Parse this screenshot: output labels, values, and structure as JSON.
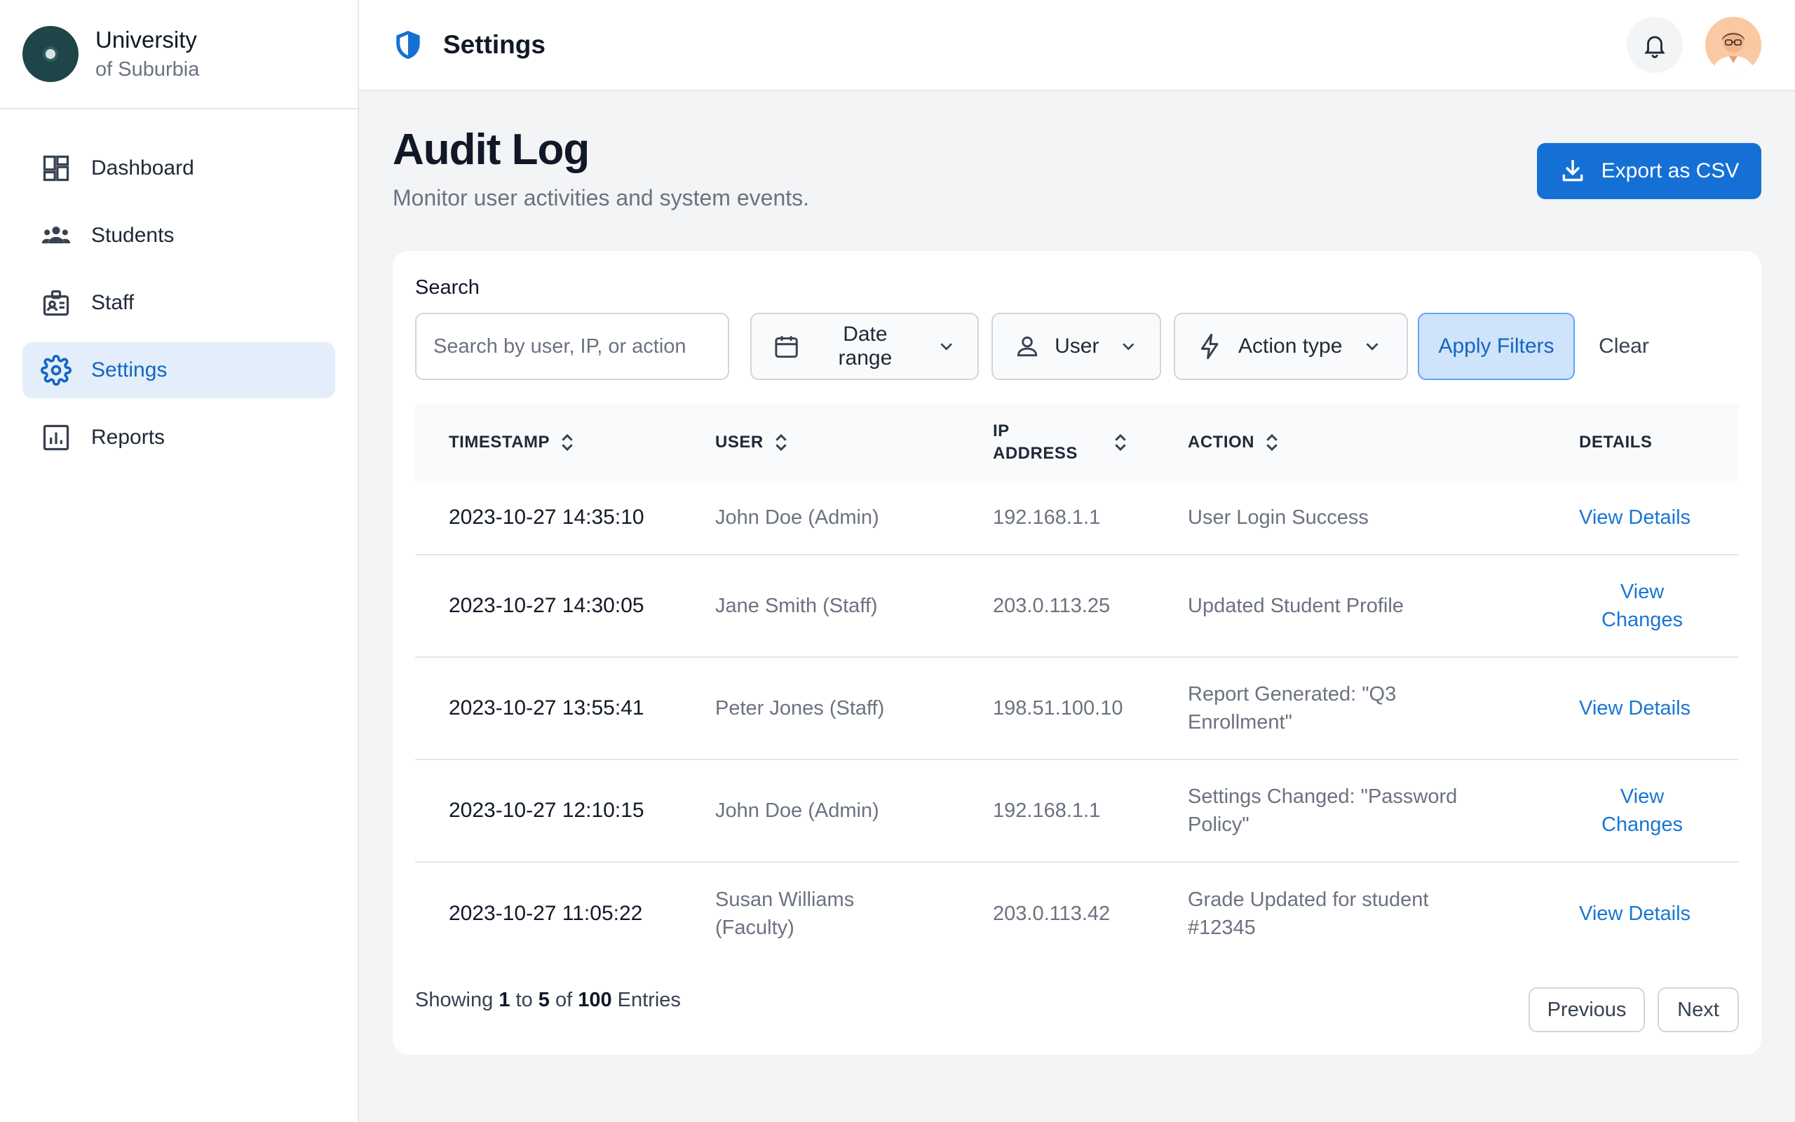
{
  "brand": {
    "line1": "University",
    "line2": "of Suburbia"
  },
  "sidebar": {
    "items": [
      {
        "label": "Dashboard",
        "icon": "dashboard-icon"
      },
      {
        "label": "Students",
        "icon": "students-icon"
      },
      {
        "label": "Staff",
        "icon": "staff-badge-icon"
      },
      {
        "label": "Settings",
        "icon": "gear-icon",
        "active": true
      },
      {
        "label": "Reports",
        "icon": "bar-chart-icon"
      }
    ]
  },
  "header": {
    "title": "Settings",
    "icon": "shield-icon"
  },
  "page": {
    "title": "Audit Log",
    "subtitle": "Monitor user activities and system events.",
    "export_label": "Export as CSV"
  },
  "filters": {
    "search_label": "Search",
    "search_placeholder": "Search by user, IP, or action",
    "date_range": "Date range",
    "user": "User",
    "action_type": "Action type",
    "apply": "Apply Filters",
    "clear": "Clear"
  },
  "table": {
    "headers": {
      "timestamp": "TIMESTAMP",
      "user": "USER",
      "ip_line1": "IP",
      "ip_line2": "ADDRESS",
      "action": "ACTION",
      "details": "DETAILS"
    },
    "rows": [
      {
        "timestamp": "2023-10-27 14:35:10",
        "user": "John Doe (Admin)",
        "ip": "192.168.1.1",
        "action": "User Login Success",
        "details": "View Details"
      },
      {
        "timestamp": "2023-10-27 14:30:05",
        "user": "Jane Smith (Staff)",
        "ip": "203.0.113.25",
        "action": "Updated Student Profile",
        "details": "View Changes"
      },
      {
        "timestamp": "2023-10-27 13:55:41",
        "user": "Peter Jones (Staff)",
        "ip": "198.51.100.10",
        "action": "Report Generated: \"Q3 Enrollment\"",
        "details": "View Details"
      },
      {
        "timestamp": "2023-10-27 12:10:15",
        "user": "John Doe (Admin)",
        "ip": "192.168.1.1",
        "action": "Settings Changed: \"Password Policy\"",
        "details": "View Changes"
      },
      {
        "timestamp": "2023-10-27 11:05:22",
        "user": "Susan Williams (Faculty)",
        "ip": "203.0.113.42",
        "action": "Grade Updated for student #12345",
        "details": "View Details"
      }
    ]
  },
  "pagination": {
    "showing": "Showing",
    "from": "1",
    "to_word": "to",
    "to": "5",
    "of_word": "of",
    "total": "100",
    "entries": "Entries",
    "previous": "Previous",
    "next": "Next"
  },
  "colors": {
    "accent": "#1570d6",
    "active_nav_bg": "#e3eefa",
    "link": "#1976d2"
  }
}
